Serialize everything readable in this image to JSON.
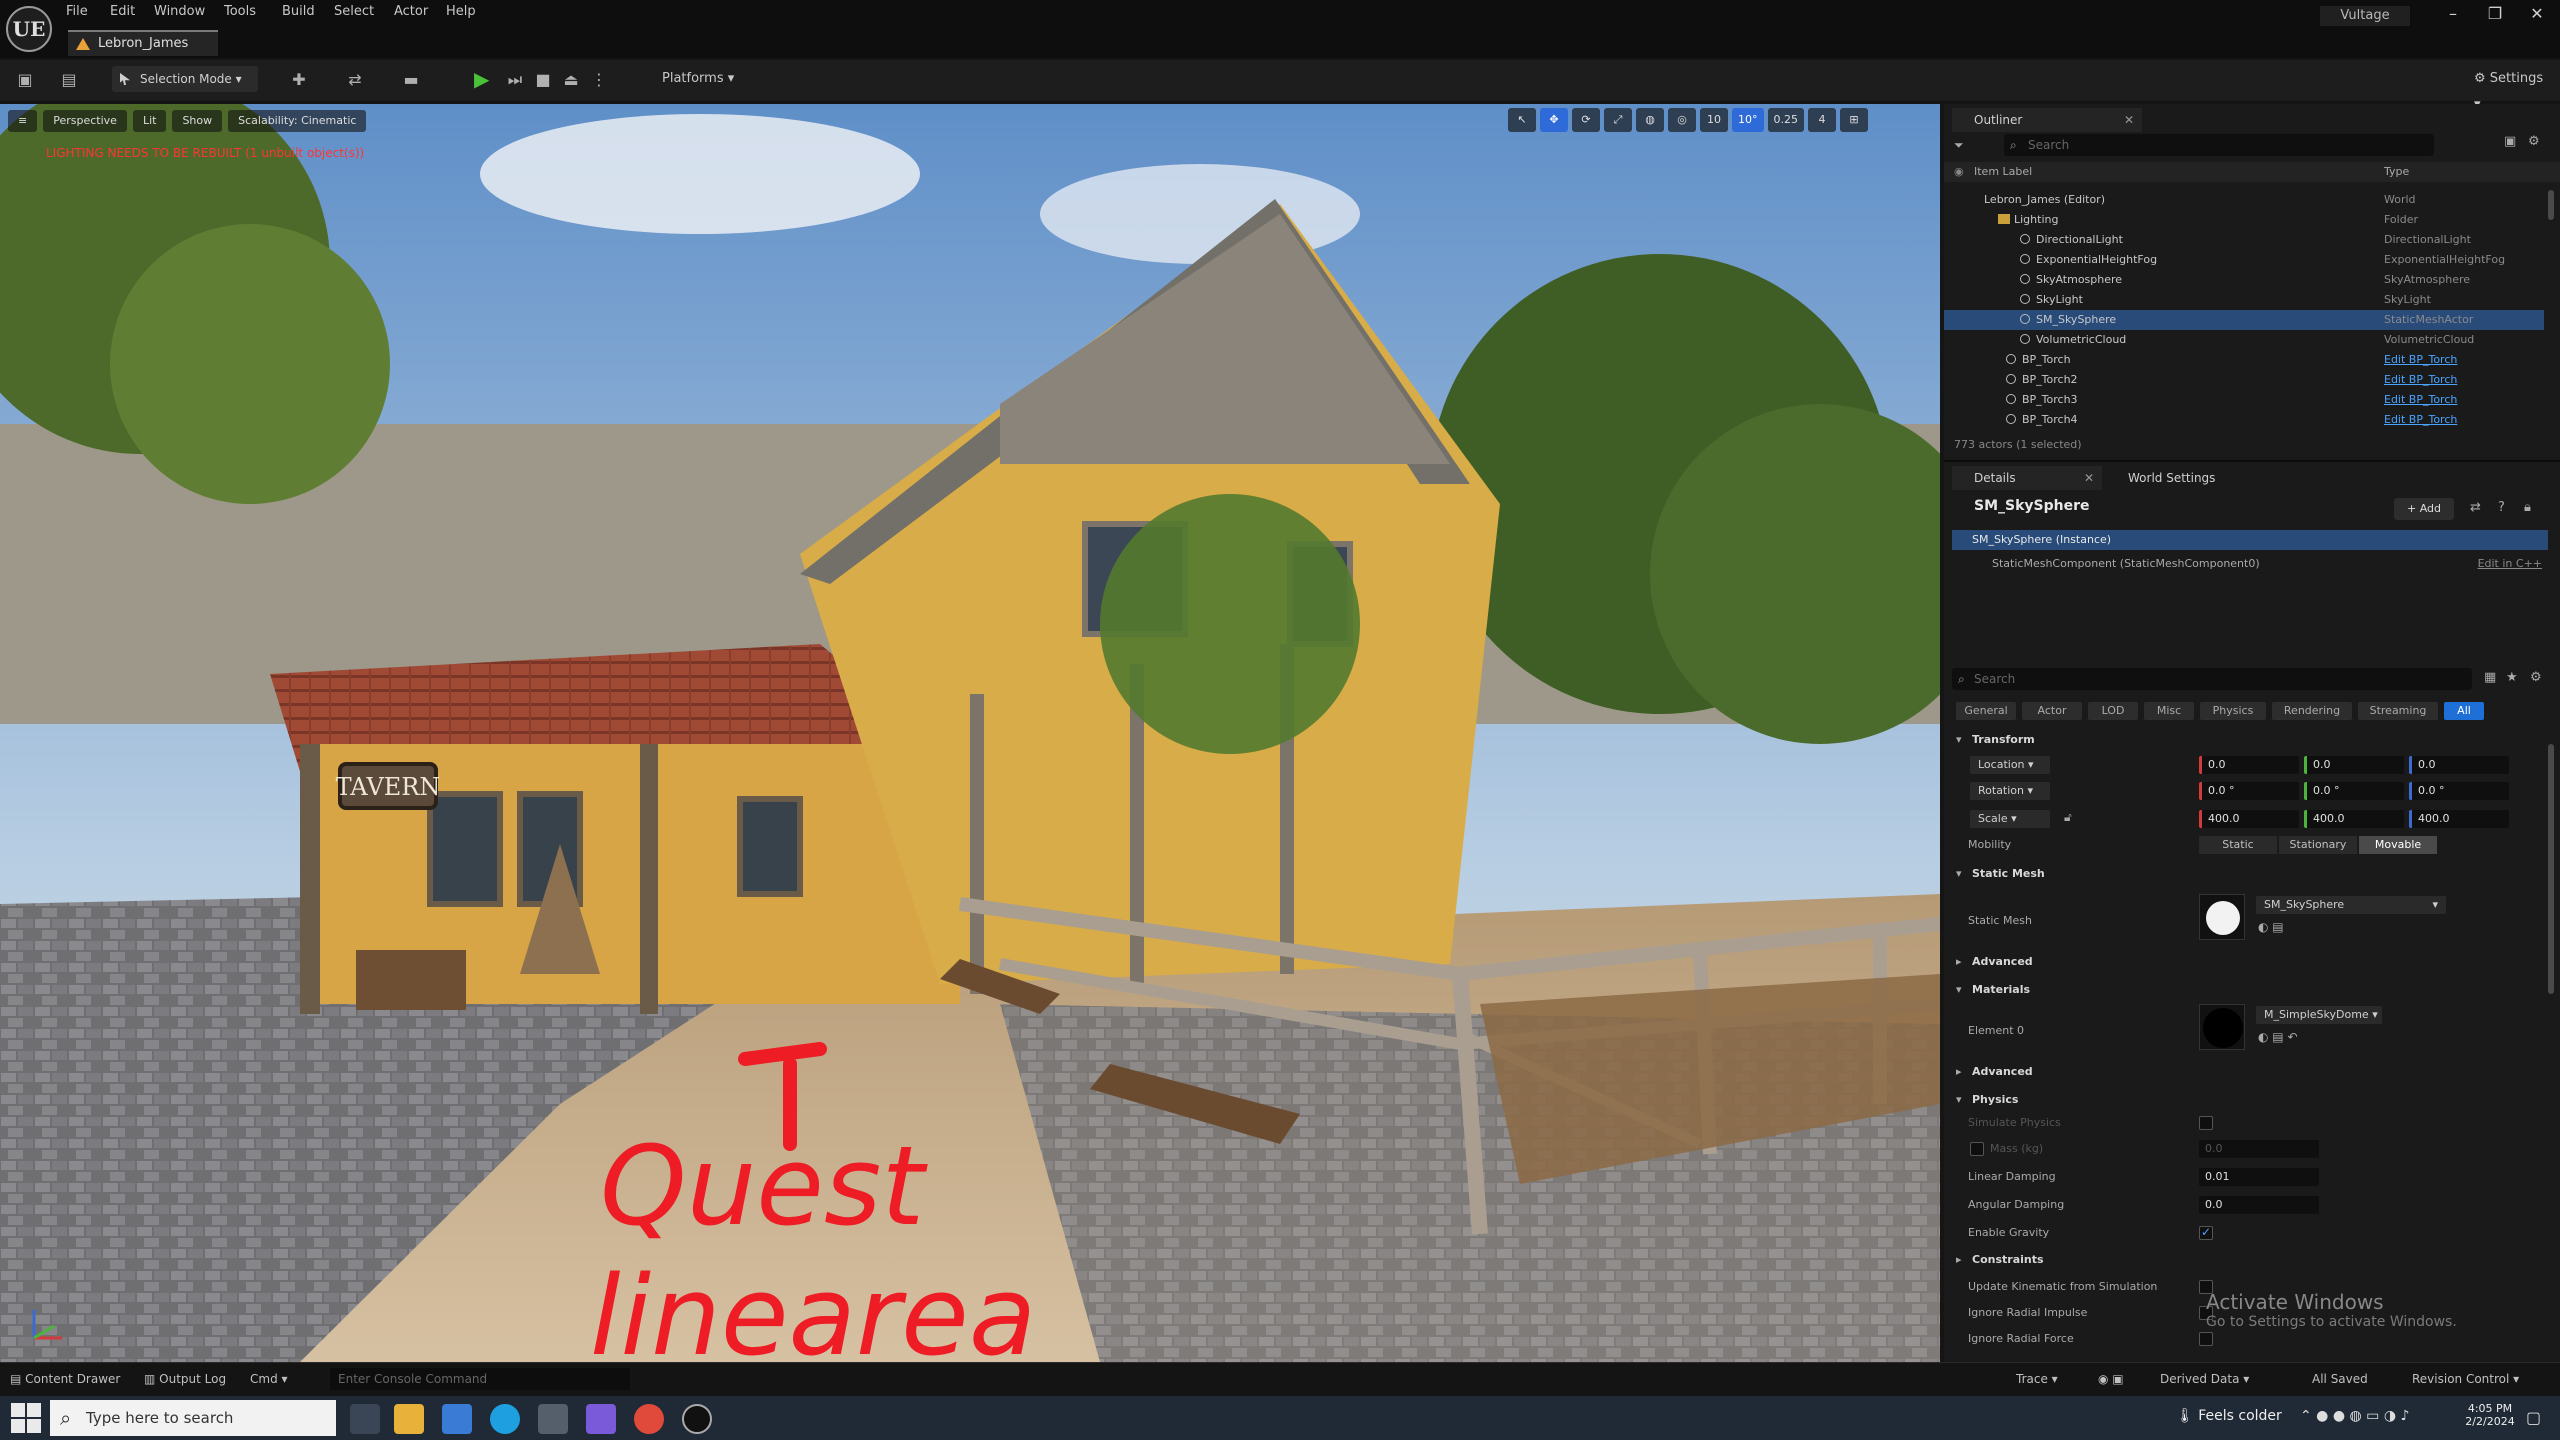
{
  "app": {
    "logo": "UE",
    "project_name": "Vultage",
    "document_tab": "Lebron_James",
    "menu": [
      "File",
      "Edit",
      "Window",
      "Tools",
      "Build",
      "Select",
      "Actor",
      "Help"
    ],
    "window_controls": {
      "minimize": "–",
      "maximize": "❐",
      "close": "✕"
    }
  },
  "toolbar": {
    "selection_mode": "Selection Mode",
    "platforms": "Platforms",
    "settings": "Settings"
  },
  "viewport": {
    "perspective": "Perspective",
    "lit": "Lit",
    "show": "Show",
    "scalability": "Scalability: Cinematic",
    "warning": "LIGHTING NEEDS TO BE REBUILT (1 unbuilt object(s))",
    "tools": [
      "10",
      "10°",
      "0.25",
      "4"
    ],
    "sign_text": "TAVERN",
    "annotation_line1": "Quest",
    "annotation_line2": "linearea"
  },
  "outliner": {
    "tab": "Outliner",
    "search_placeholder": "Search",
    "col_label": "Item Label",
    "col_type": "Type",
    "rows": [
      {
        "label": "Lebron_James (Editor)",
        "type": "World"
      },
      {
        "label": "Lighting",
        "type": "Folder"
      },
      {
        "label": "DirectionalLight",
        "type": "DirectionalLight"
      },
      {
        "label": "ExponentialHeightFog",
        "type": "ExponentialHeightFog"
      },
      {
        "label": "SkyAtmosphere",
        "type": "SkyAtmosphere"
      },
      {
        "label": "SkyLight",
        "type": "SkyLight"
      },
      {
        "label": "SM_SkySphere",
        "type": "StaticMeshActor"
      },
      {
        "label": "VolumetricCloud",
        "type": "VolumetricCloud"
      },
      {
        "label": "BP_Torch",
        "type": "Edit BP_Torch"
      },
      {
        "label": "BP_Torch2",
        "type": "Edit BP_Torch"
      },
      {
        "label": "BP_Torch3",
        "type": "Edit BP_Torch"
      },
      {
        "label": "BP_Torch4",
        "type": "Edit BP_Torch"
      }
    ],
    "summary": "773 actors (1 selected)"
  },
  "details": {
    "tab": "Details",
    "tab2": "World Settings",
    "actor_name": "SM_SkySphere",
    "add_label": "+ Add",
    "instance": "SM_SkySphere (Instance)",
    "component": "StaticMeshComponent (StaticMeshComponent0)",
    "component_link": "Edit in C++",
    "search_placeholder": "Search",
    "filters": [
      "General",
      "Actor",
      "LOD",
      "Misc",
      "Physics",
      "Rendering",
      "Streaming",
      "All"
    ],
    "transform": {
      "title": "Transform",
      "location_label": "Location",
      "rotation_label": "Rotation",
      "scale_label": "Scale",
      "location": [
        "0.0",
        "0.0",
        "0.0"
      ],
      "rotation": [
        "0.0 °",
        "0.0 °",
        "0.0 °"
      ],
      "scale": [
        "400.0",
        "400.0",
        "400.0"
      ],
      "mobility_label": "Mobility",
      "mobility": [
        "Static",
        "Stationary",
        "Movable"
      ]
    },
    "static_mesh": {
      "title": "Static Mesh",
      "label": "Static Mesh",
      "value": "SM_SkySphere"
    },
    "advanced": "Advanced",
    "materials": {
      "title": "Materials",
      "label": "Element 0",
      "value": "M_SimpleSkyDome"
    },
    "physics": {
      "title": "Physics",
      "simulate": "Simulate Physics",
      "mass": "Mass (kg)",
      "mass_value": "0.0",
      "linear_damping": "Linear Damping",
      "linear_value": "0.01",
      "angular_damping": "Angular Damping",
      "angular_value": "0.0",
      "gravity": "Enable Gravity"
    },
    "constraints": "Constraints",
    "update_kinematic": "Update Kinematic from Simulation",
    "ignore_radial_impulse": "Ignore Radial Impulse",
    "ignore_radial_force": "Ignore Radial Force"
  },
  "activate": {
    "title": "Activate Windows",
    "sub": "Go to Settings to activate Windows."
  },
  "statusbar": {
    "content_drawer": "Content Drawer",
    "output_log": "Output Log",
    "cmd": "Cmd",
    "console_placeholder": "Enter Console Command",
    "trace": "Trace",
    "derived_data": "Derived Data",
    "all_saved": "All Saved",
    "revision_control": "Revision Control"
  },
  "taskbar": {
    "search_placeholder": "Type here to search",
    "weather": "Feels colder",
    "time": "4:05 PM",
    "date": "2/2/2024"
  }
}
